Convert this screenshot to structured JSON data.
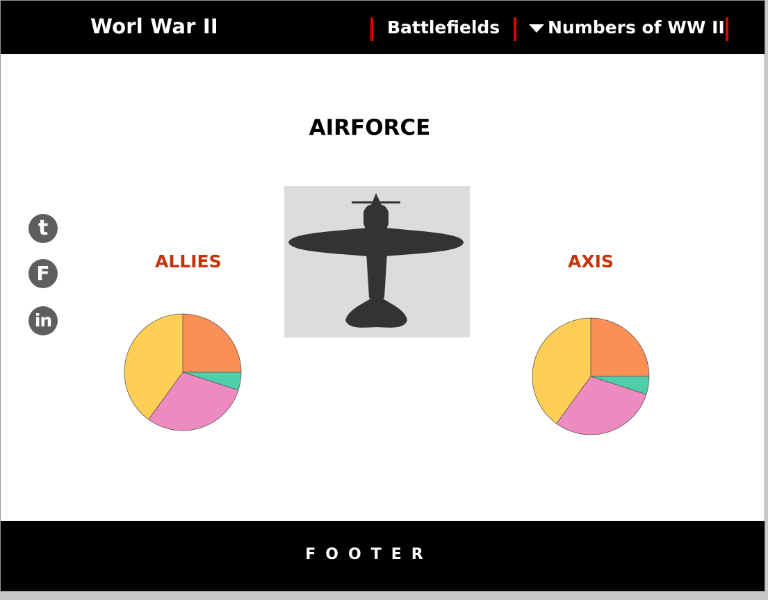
{
  "header": {
    "logo": "Worl War II",
    "nav": {
      "battlefields": "Battlefields",
      "numbers": "Numbers of WW II"
    },
    "separator_color": "#e00000"
  },
  "main": {
    "title": "AIRFORCE",
    "image_icon": "airplane-silhouette-icon",
    "allies_label": "ALLIES",
    "axis_label": "AXIS",
    "label_color": "#c8320a"
  },
  "social": [
    {
      "name": "tumblr-icon",
      "glyph": "t"
    },
    {
      "name": "facebook-icon",
      "glyph": "F"
    },
    {
      "name": "linkedin-icon",
      "glyph": "in"
    }
  ],
  "chart_data": [
    {
      "type": "pie",
      "slices": [
        {
          "value": 25,
          "color": "#fb8f55"
        },
        {
          "value": 5,
          "color": "#4ecfa9"
        },
        {
          "value": 30,
          "color": "#ed8ac0"
        },
        {
          "value": 40,
          "color": "#ffce55"
        }
      ]
    },
    {
      "type": "pie",
      "slices": [
        {
          "value": 25,
          "color": "#fb8f55"
        },
        {
          "value": 5,
          "color": "#4ecfa9"
        },
        {
          "value": 30,
          "color": "#ed8ac0"
        },
        {
          "value": 40,
          "color": "#ffce55"
        }
      ]
    }
  ],
  "footer": {
    "text": "FOOTER"
  }
}
